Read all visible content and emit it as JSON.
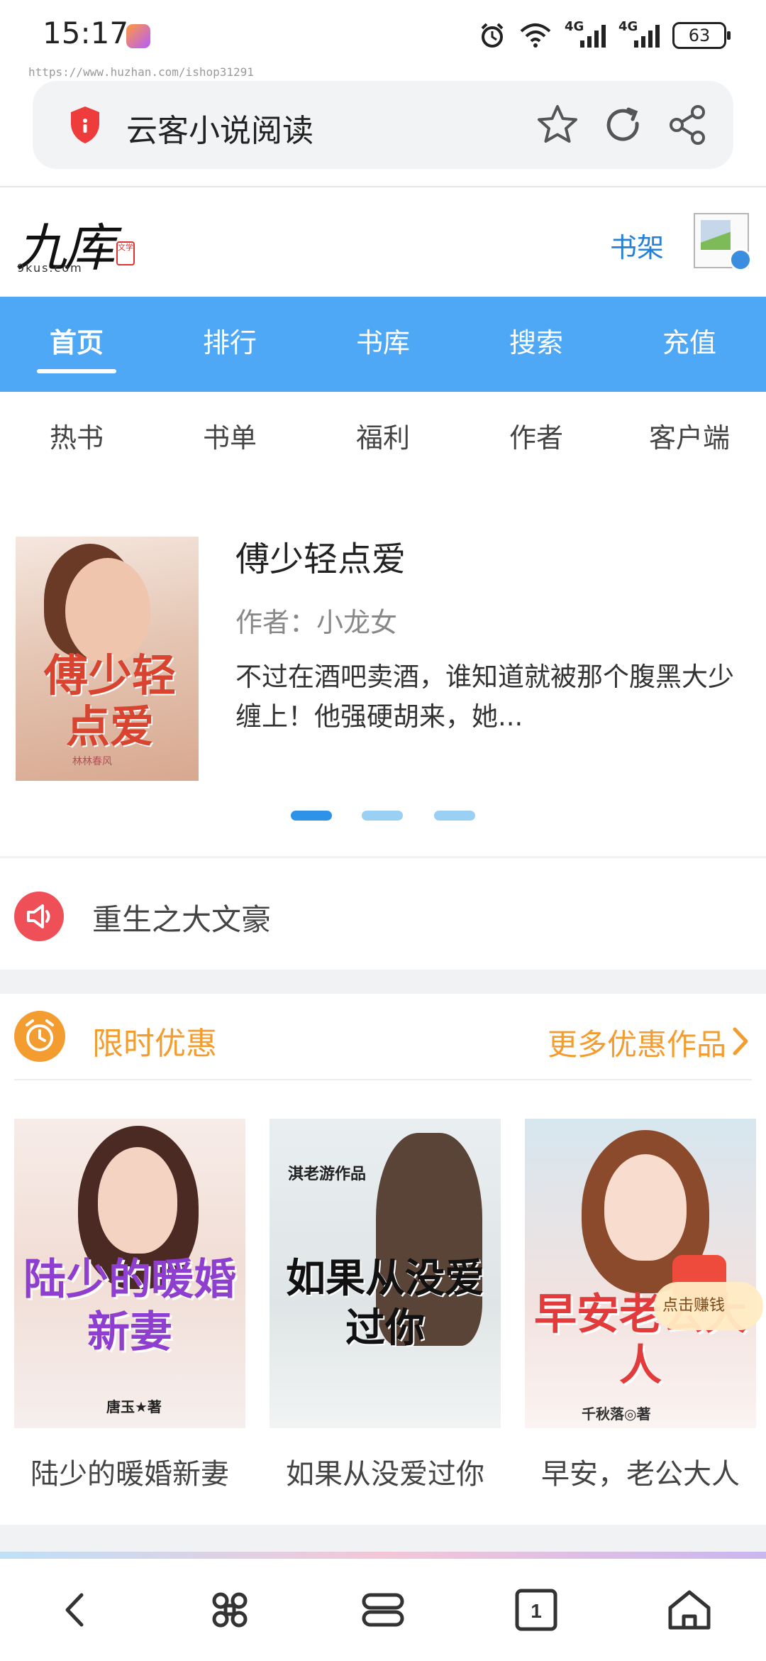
{
  "status_bar": {
    "time": "15:17",
    "network_1": "4G",
    "network_2": "4G",
    "battery": "63"
  },
  "url_hint": "https://www.huzhan.com/ishop31291",
  "browser": {
    "title": "云客小说阅读"
  },
  "site": {
    "logo_main": "九库",
    "logo_sub": "9kus.com",
    "logo_seal": "文学",
    "shelf_label": "书架"
  },
  "main_nav": [
    "首页",
    "排行",
    "书库",
    "搜索",
    "充值"
  ],
  "sub_nav": [
    "热书",
    "书单",
    "福利",
    "作者",
    "客户端"
  ],
  "featured": {
    "cover_title": "傅少轻点爱",
    "cover_author": "林林春风",
    "title": "傅少轻点爱",
    "author": "作者：小龙女",
    "description": "不过在酒吧卖酒，谁知道就被那个腹黑大少缠上！他强硬胡来，她..."
  },
  "notice": {
    "text": "重生之大文豪"
  },
  "promo": {
    "title": "限时优惠",
    "more": "更多优惠作品",
    "books": [
      {
        "name": "陆少的暖婚新妻",
        "cover_title": "陆少的暖婚新妻",
        "cover_author": "唐玉★著"
      },
      {
        "name": "如果从没爱过你",
        "cover_title": "如果从没爱过你",
        "cover_author": "淇老游作品"
      },
      {
        "name": "早安，老公大人",
        "cover_title": "早安老公大人",
        "cover_author": "千秋落◎著"
      }
    ],
    "earn_badge": "点击赚钱"
  }
}
